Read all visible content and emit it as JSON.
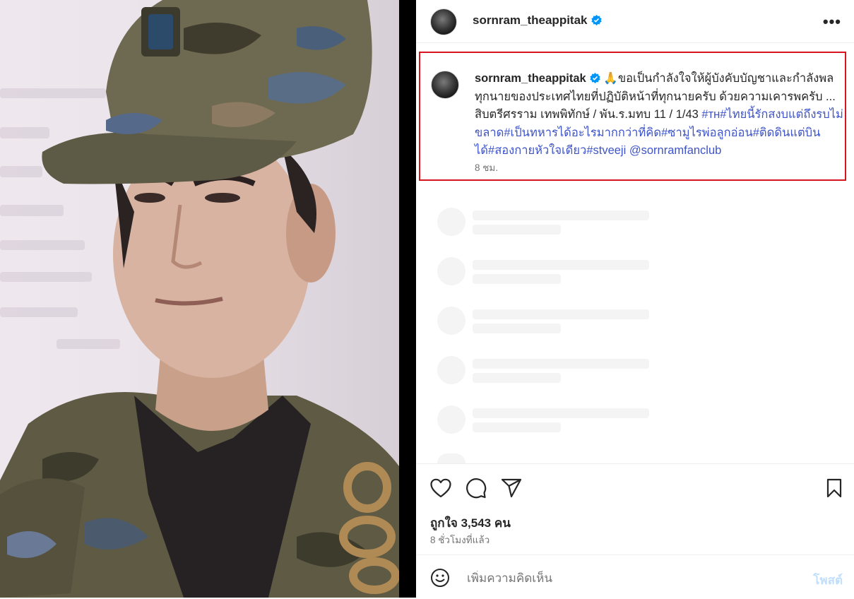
{
  "post": {
    "username": "sornram_theappitak",
    "more_icon": "more-horizontal-icon",
    "caption": {
      "username": "sornram_theappitak",
      "emoji": "🙏",
      "text": "ขอเป็นกำลังใจให้ผู้บังคับบัญชาและกำลังพลทุกนายของประเทศไทยที่ปฏิบัติหน้าที่ทุกนายครับ ด้วยความเคารพครับ ... สิบตรีศรราม เทพพิทักษ์ / พัน.ร.มทบ 11 / 1/43 ",
      "tags": [
        "#ᴛʜ",
        "#ไทยนี้รักสงบแต่ถึงรบไม่ขลาด",
        "#เป็นทหารได้อะไรมากกว่าที่คิด",
        "#ซามูไรพ่อลูกอ่อน",
        "#ติดดินแต่บินได้",
        "#สองกายหัวใจเดียว",
        "#stveeji"
      ],
      "mention": "@sornramfanclub",
      "time": "8 ชม."
    },
    "likes": "ถูกใจ 3,543 คน",
    "posted_ago": "8 ชั่วโมงที่แล้ว",
    "comment": {
      "placeholder": "เพิ่มความคิดเห็น",
      "post_label": "โพสต์"
    },
    "colors": {
      "link": "#3e54c8",
      "highlight_border": "#d6161f",
      "verified": "#0095f6"
    }
  }
}
